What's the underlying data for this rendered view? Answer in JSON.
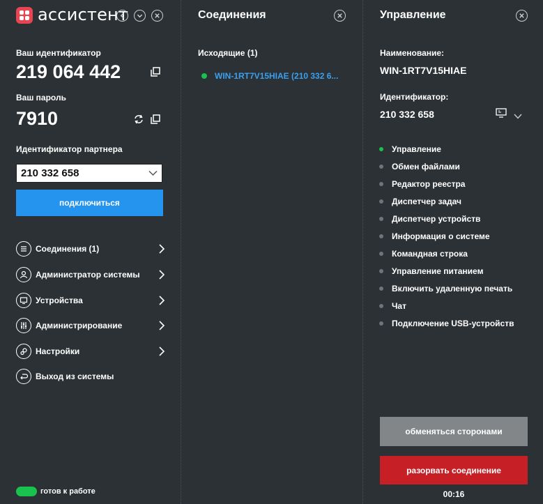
{
  "app": {
    "title": "ассистент"
  },
  "left": {
    "id_label": "Ваш идентификатор",
    "id_value": "219 064 442",
    "password_label": "Ваш пароль",
    "password_value": "7910",
    "partner_label": "Идентификатор партнера",
    "partner_value": "210 332 658",
    "connect_label": "подключиться",
    "nav": [
      {
        "label": "Соединения (1)",
        "icon": "list-icon"
      },
      {
        "label": "Администратор системы",
        "icon": "user-icon"
      },
      {
        "label": "Устройства",
        "icon": "monitor-icon"
      },
      {
        "label": "Администрирование",
        "icon": "sliders-icon"
      },
      {
        "label": "Настройки",
        "icon": "gears-icon"
      },
      {
        "label": "Выход из системы",
        "icon": "logout-icon"
      }
    ],
    "status": "готов к работе"
  },
  "middle": {
    "title": "Соединения",
    "outgoing_label": "Исходящие (1)",
    "connection_label": "WIN-1RT7V15HIAE (210 332 6..."
  },
  "right": {
    "title": "Управление",
    "name_label": "Наименование:",
    "name_value": "WIN-1RT7V15HIAE",
    "id_label": "Идентификатор:",
    "id_value": "210 332 658",
    "features": [
      "Управление",
      "Обмен файлами",
      "Редактор реестра",
      "Диспетчер задач",
      "Диспетчер устройств",
      "Информация о системе",
      "Командная строка",
      "Управление питанием",
      "Включить удаленную печать",
      "Чат",
      "Подключение USB-устройств"
    ],
    "active_feature_index": 0,
    "swap_label": "обменяться сторонами",
    "break_label": "разорвать соединение",
    "timer": "00:16"
  },
  "colors": {
    "background": "#2b3135",
    "accent_blue": "#2494ee",
    "status_green": "#19c24f",
    "danger_red": "#c62026",
    "logo_red": "#e94452",
    "swap_gray": "#828689"
  }
}
